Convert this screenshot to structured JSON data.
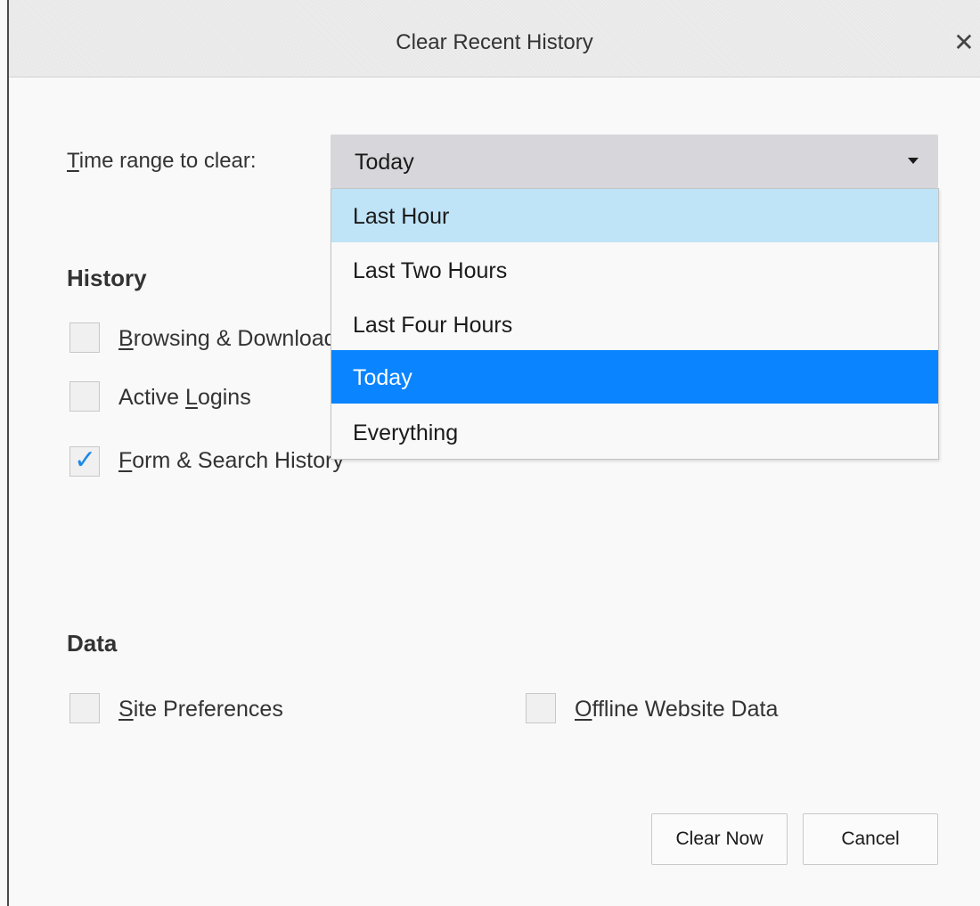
{
  "window": {
    "title": "Clear Recent History",
    "close_glyph": "✕"
  },
  "time_range": {
    "label_first": "T",
    "label_rest": "ime range to clear:",
    "selected_value": "Today",
    "options": [
      "Last Hour",
      "Last Two Hours",
      "Last Four Hours",
      "Today",
      "Everything"
    ],
    "hovered_option": "Last Hour"
  },
  "history": {
    "heading": "History",
    "items": [
      {
        "key_letter": "B",
        "rest": "rowsing & Download History",
        "checked": false
      },
      {
        "pre": "Active ",
        "key_letter": "L",
        "rest": "ogins",
        "checked": false
      },
      {
        "key_letter": "F",
        "rest": "orm & Search History",
        "checked": true
      }
    ]
  },
  "data": {
    "heading": "Data",
    "items": [
      {
        "key_letter": "S",
        "rest": "ite Preferences",
        "checked": false
      },
      {
        "key_letter": "O",
        "rest": "ffline Website Data",
        "checked": false
      }
    ]
  },
  "buttons": {
    "clear_now": "Clear Now",
    "cancel": "Cancel"
  },
  "colors": {
    "selected_option": "#0a84ff",
    "hovered_option": "#bfe3f7",
    "checkmark": "#1e88e5"
  },
  "icons": {
    "close": "close-icon",
    "dropdown": "dropdown-arrow-icon",
    "check": "checkmark-icon"
  }
}
